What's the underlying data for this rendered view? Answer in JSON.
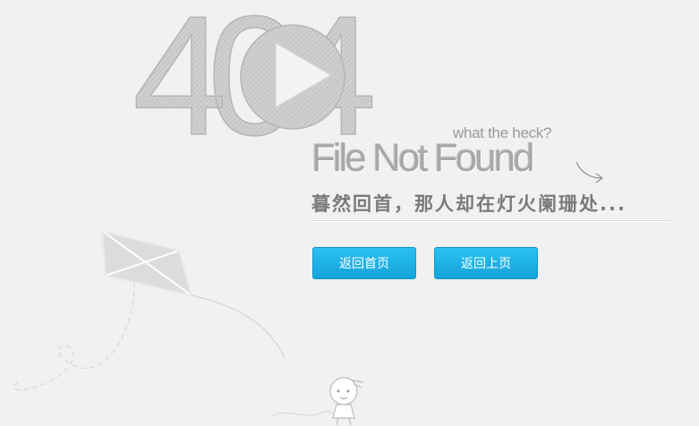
{
  "error": {
    "code": "404",
    "tagline": "what the heck?",
    "title": "File Not Found",
    "subtitle": "暮然回首，那人却在灯火阑珊处..."
  },
  "actions": {
    "home_label": "返回首页",
    "back_label": "返回上页"
  },
  "icons": {
    "play": "play-icon",
    "kite": "kite-illustration",
    "person": "person-illustration"
  },
  "colors": {
    "background": "#f1f1f1",
    "button": "#1aaee4",
    "text": "#a8a8a8"
  }
}
